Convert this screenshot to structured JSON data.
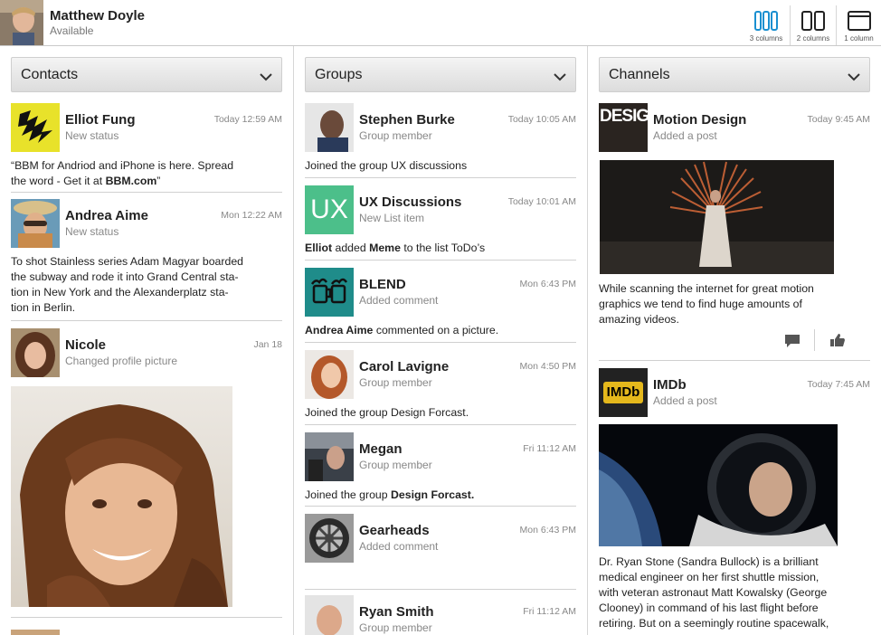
{
  "user": {
    "name": "Matthew Doyle",
    "status": "Available"
  },
  "view_modes": [
    {
      "label": "3 columns",
      "active": true
    },
    {
      "label": "2 columns",
      "active": false
    },
    {
      "label": "1 column",
      "active": false
    }
  ],
  "columns": {
    "contacts": {
      "title": "Contacts",
      "items": [
        {
          "name": "Elliot Fung",
          "subtitle": "New status",
          "time": "Today 12:59 AM",
          "body_line1": "“BBM for Andriod and iPhone is here. Spread",
          "body_line2_pre": "the word - Get it at ",
          "body_line2_bold": "BBM.com",
          "body_line2_post": "”"
        },
        {
          "name": "Andrea Aime",
          "subtitle": "New status",
          "time": "Mon 12:22 AM",
          "body_lines": [
            "To shot Stainless series Adam Magyar boarded",
            "the subway and rode it into Grand Central sta-",
            "tion in New York and the Alexanderplatz sta-",
            "tion in Berlin."
          ]
        },
        {
          "name": "Nicole",
          "subtitle": "Changed profile picture",
          "time": "Jan 18"
        }
      ]
    },
    "groups": {
      "title": "Groups",
      "items": [
        {
          "name": "Stephen Burke",
          "subtitle": "Group member",
          "time": "Today 10:05 AM",
          "body": "Joined the group UX discussions"
        },
        {
          "name": "UX Discussions",
          "subtitle": "New List item",
          "time": "Today 10:01 AM",
          "thumb_text": "UX",
          "body_b1": "Elliot",
          "body_t1": " added ",
          "body_b2": "Meme",
          "body_t2": " to the list ToDo’s"
        },
        {
          "name": "BLEND",
          "subtitle": "Added comment",
          "time": "Mon 6:43 PM",
          "body_b1": "Andrea Aime",
          "body_t1": " commented on a picture."
        },
        {
          "name": "Carol Lavigne",
          "subtitle": "Group member",
          "time": "Mon 4:50 PM",
          "body": "Joined the group Design Forcast."
        },
        {
          "name": "Megan",
          "subtitle": "Group member",
          "time": "Fri 11:12 AM",
          "body_t1": "Joined the group ",
          "body_b1": "Design Forcast."
        },
        {
          "name": "Gearheads",
          "subtitle": "Added comment",
          "time": "Mon 6:43 PM"
        },
        {
          "name": "Ryan Smith",
          "subtitle": "Group member",
          "time": "Fri 11:12 AM"
        }
      ]
    },
    "channels": {
      "title": "Channels",
      "items": [
        {
          "name": "Motion Design",
          "subtitle": "Added a post",
          "time": "Today 9:45 AM",
          "thumb_text": "DESIG",
          "body_lines": [
            "While scanning the internet for great motion",
            "graphics we tend to find huge amounts of",
            "amazing videos."
          ]
        },
        {
          "name": "IMDb",
          "subtitle": "Added a post",
          "time": "Today 7:45 AM",
          "thumb_text": "IMDb",
          "body_lines": [
            "Dr. Ryan Stone (Sandra Bullock) is a brilliant",
            "medical engineer on her first shuttle mission,",
            "with veteran astronaut Matt Kowalsky (George",
            "Clooney) in command of his last flight before",
            "retiring. But on a seemingly routine spacewalk,"
          ]
        }
      ]
    }
  },
  "colors": {
    "accent": "#1a8fd0",
    "ux_green": "#4cbf8a",
    "blend_teal": "#1f8c8a",
    "imdb_yellow": "#e5b81c",
    "elliot_yellow": "#e8e22a"
  },
  "icons": {
    "comment": "comment-icon",
    "like": "thumbs-up-icon",
    "chevron": "chevron-down-icon"
  }
}
